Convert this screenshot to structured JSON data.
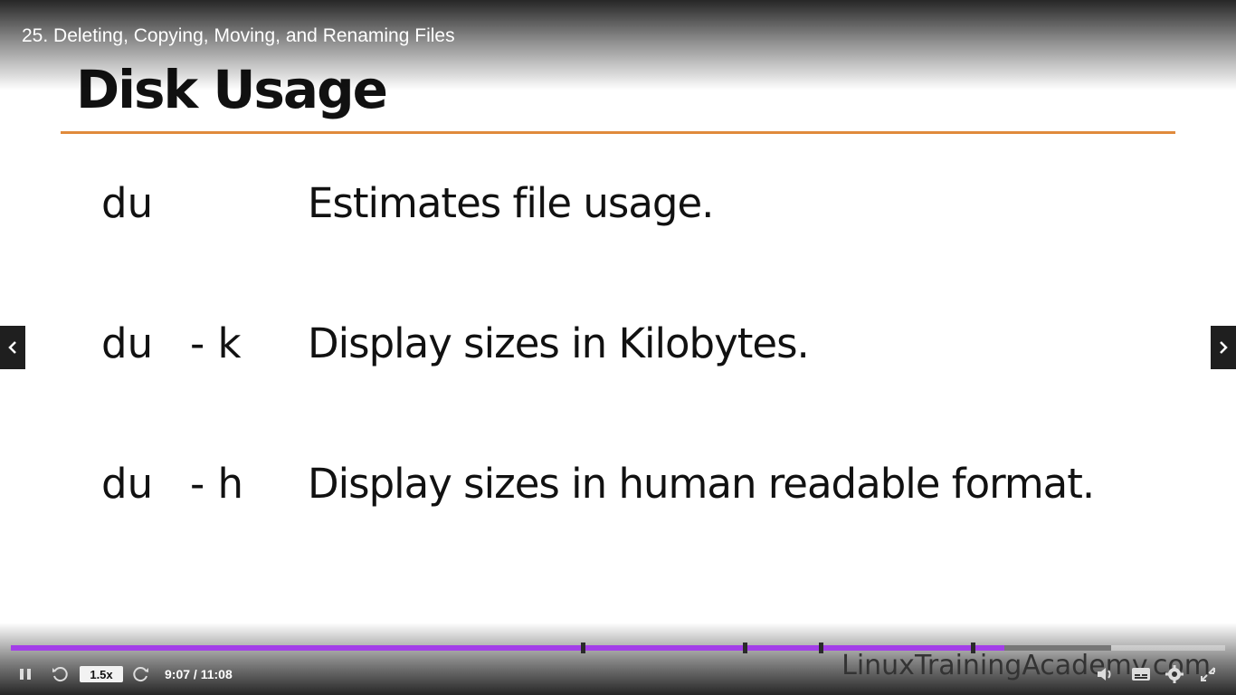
{
  "video": {
    "title": "25. Deleting, Copying, Moving, and Renaming Files"
  },
  "slide": {
    "heading": "Disk Usage",
    "rows": [
      {
        "command": "du",
        "flag": "",
        "description": "Estimates file usage."
      },
      {
        "command": "du",
        "flag": "- k",
        "description": "Display sizes in Kilobytes."
      },
      {
        "command": "du",
        "flag": "- h",
        "description": "Display sizes in human readable format."
      }
    ],
    "watermark": "LinuxTrainingAcademy.com",
    "accent_color": "#e08a3c"
  },
  "player": {
    "speed": "1.5x",
    "time_display": "9:07 / 11:08",
    "progress_played_fraction": 0.818,
    "progress_buffered_fraction": 0.906,
    "chapter_marks": [
      "4:10",
      "6:03",
      "6:35",
      "7:46"
    ],
    "played_color": "#a33ee8",
    "icons": {
      "pause": "pause-icon",
      "rewind": "rewind-icon",
      "forward": "forward-icon",
      "volume": "volume-icon",
      "captions": "captions-icon",
      "settings": "gear-icon",
      "fullscreen": "exit-fullscreen-icon",
      "prev": "chevron-left-icon",
      "next": "chevron-right-icon"
    }
  }
}
